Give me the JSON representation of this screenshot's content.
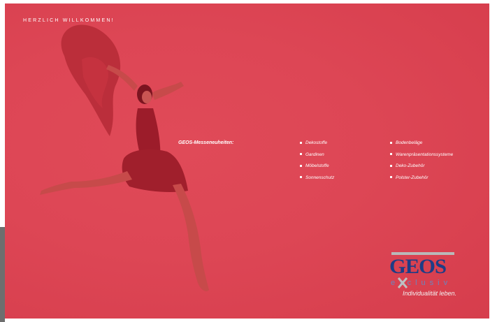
{
  "page": {
    "greeting": "HERZLICH WILLKOMMEN!"
  },
  "novelties": {
    "heading": "GEOS-Messeneuheiten:",
    "column_a": [
      "Dekostoffe",
      "Gardinen",
      "Möbelstoffe",
      "Sonnenschutz"
    ],
    "column_b": [
      "Bodenbeläge",
      "Warenpräsentationssysteme",
      "Deko-Zubehör",
      "Polster-Zubehör"
    ]
  },
  "logo": {
    "wordmark": "GEOS",
    "sub_word": "exclusiv",
    "tagline": "Individualität leben."
  },
  "colors": {
    "panel": "#dd4655",
    "logo_blue": "#1e3d86",
    "logo_light_blue": "#6a86bf",
    "logo_bar_gray": "#b9b9b9",
    "dancer_tone": "#a8202c"
  }
}
